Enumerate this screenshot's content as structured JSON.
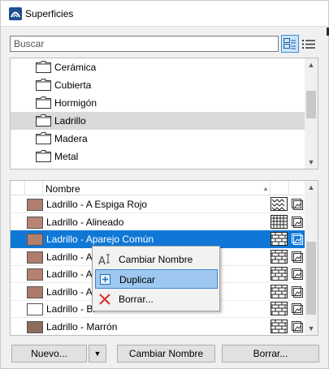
{
  "window": {
    "title": "Superficies"
  },
  "search": {
    "placeholder": "Buscar",
    "value": ""
  },
  "categories": [
    {
      "label": "Cerámica",
      "selected": false
    },
    {
      "label": "Cubierta",
      "selected": false
    },
    {
      "label": "Hormigón",
      "selected": false
    },
    {
      "label": "Ladrillo",
      "selected": true
    },
    {
      "label": "Madera",
      "selected": false
    },
    {
      "label": "Metal",
      "selected": false
    }
  ],
  "list": {
    "header": {
      "name": "Nombre"
    },
    "rows": [
      {
        "label": "Ladrillo - A Espiga Rojo",
        "swatch": "#b07e70",
        "pattern": "herringbone",
        "selected": false
      },
      {
        "label": "Ladrillo - Alineado",
        "swatch": "#b98474",
        "pattern": "grid",
        "selected": false
      },
      {
        "label": "Ladrillo - Aparejo Común",
        "swatch": "#b27f6f",
        "pattern": "brick",
        "selected": true
      },
      {
        "label": "Ladrillo - Ap",
        "swatch": "#b07c6c",
        "pattern": "brick",
        "selected": false
      },
      {
        "label": "Ladrillo - Ap",
        "swatch": "#b68270",
        "pattern": "brick",
        "selected": false
      },
      {
        "label": "Ladrillo - Ap",
        "swatch": "#ad7b6b",
        "pattern": "brick",
        "selected": false
      },
      {
        "label": "Ladrillo - Bl",
        "swatch": "#ffffff",
        "pattern": "brick",
        "selected": false
      },
      {
        "label": "Ladrillo - Marrón",
        "swatch": "#8c6b5c",
        "pattern": "brick",
        "selected": false
      }
    ]
  },
  "context_menu": {
    "items": [
      {
        "label": "Cambiar Nombre",
        "icon": "rename-icon",
        "hover": false
      },
      {
        "label": "Duplicar",
        "icon": "duplicate-icon",
        "hover": true
      },
      {
        "label": "Borrar...",
        "icon": "delete-x-icon",
        "hover": false
      }
    ]
  },
  "buttons": {
    "new_label": "Nuevo...",
    "rename_label": "Cambiar Nombre",
    "delete_label": "Borrar..."
  },
  "colors": {
    "selection": "#0f78d7",
    "menu_hover": "#9ec8ef",
    "tree_selected": "#dadada"
  }
}
